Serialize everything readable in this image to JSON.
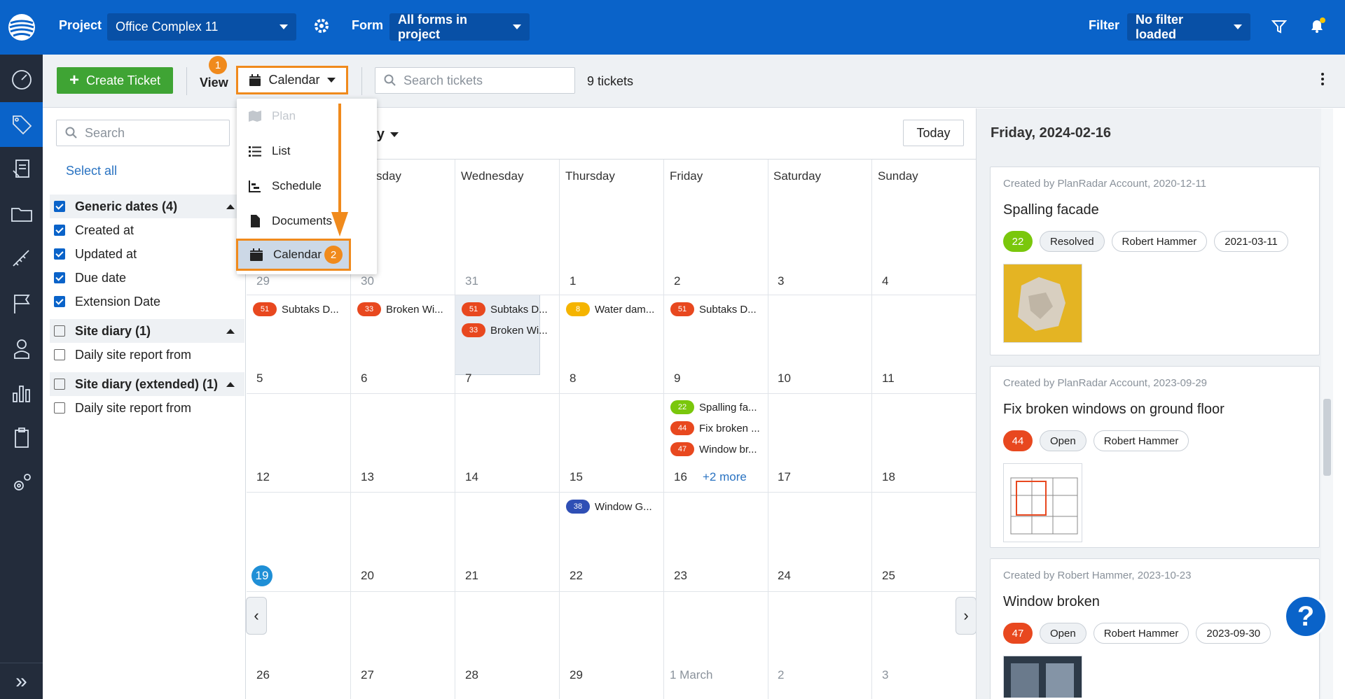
{
  "topbar": {
    "project_label": "Project",
    "project_value": "Office Complex 11",
    "form_label": "Form",
    "form_value": "All forms in project",
    "filter_label": "Filter",
    "filter_value": "No filter loaded"
  },
  "toolbar": {
    "create_label": "Create Ticket",
    "view_label": "View",
    "view_value": "Calendar",
    "search_placeholder": "Search tickets",
    "ticket_count": "9 tickets",
    "marker_1": "1",
    "marker_2": "2"
  },
  "dropdown": {
    "items": [
      {
        "label": "Plan",
        "icon": "map-icon",
        "disabled": true
      },
      {
        "label": "List",
        "icon": "list-icon"
      },
      {
        "label": "Schedule",
        "icon": "schedule-icon"
      },
      {
        "label": "Documents",
        "icon": "document-icon"
      },
      {
        "label": "Calendar",
        "icon": "calendar-icon",
        "selected": true
      }
    ]
  },
  "filters": {
    "search_placeholder": "Search",
    "select_all": "Select all",
    "rows": [
      {
        "label": "Generic dates (4)",
        "group": true,
        "checked": true
      },
      {
        "label": "Created at",
        "checked": true
      },
      {
        "label": "Updated at",
        "checked": true
      },
      {
        "label": "Due date",
        "checked": true
      },
      {
        "label": "Extension Date",
        "checked": true
      },
      {
        "label": "Site diary (1)",
        "group": true,
        "checked": false
      },
      {
        "label": "Daily site report from",
        "checked": false
      },
      {
        "label": "Site diary (extended) (1)",
        "group": true,
        "checked": false
      },
      {
        "label": "Daily site report from",
        "checked": false
      }
    ]
  },
  "calendar": {
    "title_visible": "ry",
    "today_label": "Today",
    "day_headers": [
      "sday",
      "Wednesday",
      "Thursday",
      "Friday",
      "Saturday",
      "Sunday"
    ],
    "weeks": [
      [
        "29",
        "30",
        "31",
        "1",
        "2",
        "3",
        "4"
      ],
      [
        "5",
        "6",
        "7",
        "8",
        "9",
        "10",
        "11"
      ],
      [
        "12",
        "13",
        "14",
        "15",
        "16",
        "17",
        "18"
      ],
      [
        "19",
        "20",
        "21",
        "22",
        "23",
        "24",
        "25"
      ],
      [
        "26",
        "27",
        "28",
        "29",
        "1 March",
        "2",
        "3"
      ]
    ],
    "events": {
      "w1_mon": {
        "num": "51",
        "text": "Subtaks D...",
        "color": "#e8481f"
      },
      "w1_tue": {
        "num": "33",
        "text": "Broken Wi...",
        "color": "#e8481f"
      },
      "w1_wed_a": {
        "num": "51",
        "text": "Subtaks D...",
        "color": "#e8481f"
      },
      "w1_wed_b": {
        "num": "33",
        "text": "Broken Wi...",
        "color": "#e8481f"
      },
      "w1_thu": {
        "num": "8",
        "text": "Water dam...",
        "color": "#f5b400"
      },
      "w1_fri": {
        "num": "51",
        "text": "Subtaks D...",
        "color": "#e8481f"
      },
      "w2_fri_a": {
        "num": "22",
        "text": "Spalling fa...",
        "color": "#7ac70c"
      },
      "w2_fri_b": {
        "num": "44",
        "text": "Fix broken ...",
        "color": "#e8481f"
      },
      "w2_fri_c": {
        "num": "47",
        "text": "Window br...",
        "color": "#e8481f"
      },
      "w3_thu": {
        "num": "38",
        "text": "Window G...",
        "color": "#2f4fb5"
      }
    },
    "more_label": "+2 more"
  },
  "right_panel": {
    "date": "Friday, 2024-02-16",
    "cards": [
      {
        "by": "Created by PlanRadar Account, 2020-12-11",
        "title": "Spalling facade",
        "num": "22",
        "num_color": "#7ac70c",
        "status": "Resolved",
        "assignee": "Robert Hammer",
        "date": "2021-03-11"
      },
      {
        "by": "Created by PlanRadar Account, 2023-09-29",
        "title": "Fix broken windows on ground floor",
        "num": "44",
        "num_color": "#e8481f",
        "status": "Open",
        "assignee": "Robert Hammer",
        "date": ""
      },
      {
        "by": "Created by Robert Hammer, 2023-10-23",
        "title": "Window broken",
        "num": "47",
        "num_color": "#e8481f",
        "status": "Open",
        "assignee": "Robert Hammer",
        "date": "2023-09-30"
      }
    ]
  },
  "help_label": "?"
}
